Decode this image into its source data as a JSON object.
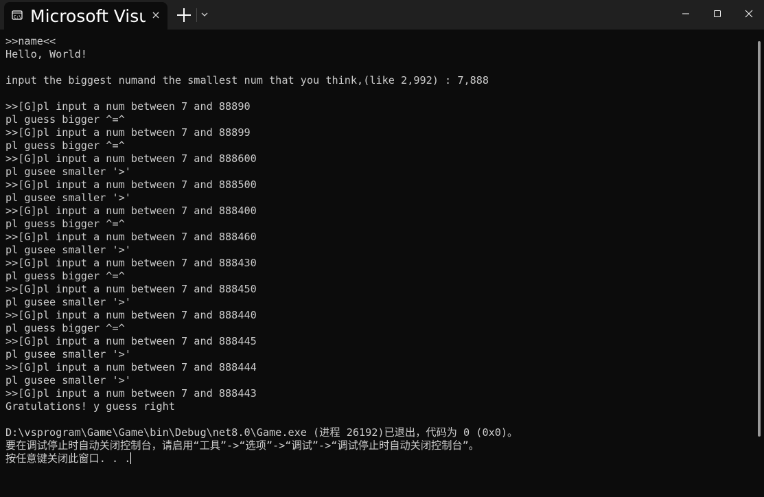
{
  "tab": {
    "title": "Microsoft Visual Studio Debug Console",
    "icon": "terminal-icon"
  },
  "window_controls": {
    "minimize_icon": "minimize-icon",
    "maximize_icon": "maximize-icon",
    "close_icon": "close-icon"
  },
  "console": {
    "lines": [
      ">>name<<",
      "Hello, World!",
      "",
      "input the biggest numand the smallest num that you think,(like 2,992) : 7,888",
      "",
      ">>[G]pl input a num between 7 and 88890",
      "pl guess bigger ^=^",
      ">>[G]pl input a num between 7 and 88899",
      "pl guess bigger ^=^",
      ">>[G]pl input a num between 7 and 888600",
      "pl gusee smaller '>'",
      ">>[G]pl input a num between 7 and 888500",
      "pl gusee smaller '>'",
      ">>[G]pl input a num between 7 and 888400",
      "pl guess bigger ^=^",
      ">>[G]pl input a num between 7 and 888460",
      "pl gusee smaller '>'",
      ">>[G]pl input a num between 7 and 888430",
      "pl guess bigger ^=^",
      ">>[G]pl input a num between 7 and 888450",
      "pl gusee smaller '>'",
      ">>[G]pl input a num between 7 and 888440",
      "pl guess bigger ^=^",
      ">>[G]pl input a num between 7 and 888445",
      "pl gusee smaller '>'",
      ">>[G]pl input a num between 7 and 888444",
      "pl gusee smaller '>'",
      ">>[G]pl input a num between 7 and 888443",
      "Gratulations! y guess right",
      "",
      "D:\\vsprogram\\Game\\Game\\bin\\Debug\\net8.0\\Game.exe (进程 26192)已退出，代码为 0 (0x0)。",
      "要在调试停止时自动关闭控制台，请启用“工具”->“选项”->“调试”->“调试停止时自动关闭控制台”。",
      "按任意键关闭此窗口. . ."
    ]
  },
  "colors": {
    "titlebar": "#202020",
    "background": "#0c0c0c",
    "text": "#cccccc"
  }
}
